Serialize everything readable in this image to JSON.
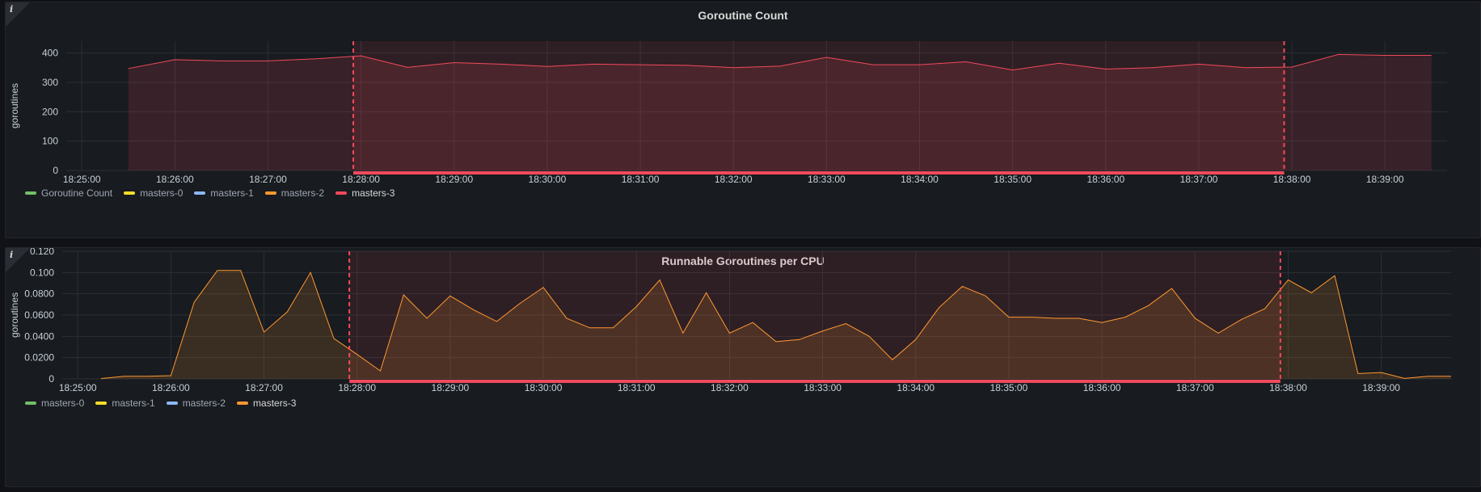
{
  "colors": {
    "grid": "#2c2f35",
    "tick": "#c7d0d9",
    "annotation": "#f2495c",
    "region": "rgba(242,73,92,0.10)"
  },
  "panels": [
    {
      "info_icon": "info-icon",
      "title": "Goroutine Count",
      "legend": [
        {
          "label": "Goroutine Count",
          "color": "#73bf69",
          "active": false
        },
        {
          "label": "masters-0",
          "color": "#fade2a",
          "active": false
        },
        {
          "label": "masters-1",
          "color": "#8ab8ff",
          "active": false
        },
        {
          "label": "masters-2",
          "color": "#ff9830",
          "active": false
        },
        {
          "label": "masters-3",
          "color": "#f2495c",
          "active": true
        }
      ]
    },
    {
      "info_icon": "info-icon",
      "title": "Runnable Goroutines per CPU",
      "legend": [
        {
          "label": "masters-0",
          "color": "#73bf69",
          "active": false
        },
        {
          "label": "masters-1",
          "color": "#fade2a",
          "active": false
        },
        {
          "label": "masters-2",
          "color": "#8ab8ff",
          "active": false
        },
        {
          "label": "masters-3",
          "color": "#ff9830",
          "active": true
        }
      ]
    }
  ],
  "chart_data": [
    {
      "type": "area",
      "title": "Goroutine Count",
      "ylabel": "goroutines",
      "xlim": [
        "18:24:50",
        "18:39:40"
      ],
      "ylim": [
        0,
        440
      ],
      "xticks": [
        "18:25:00",
        "18:26:00",
        "18:27:00",
        "18:28:00",
        "18:29:00",
        "18:30:00",
        "18:31:00",
        "18:32:00",
        "18:33:00",
        "18:34:00",
        "18:35:00",
        "18:36:00",
        "18:37:00",
        "18:38:00",
        "18:39:00"
      ],
      "yticks": [
        "0",
        "100",
        "200",
        "300",
        "400"
      ],
      "annotation_region": {
        "start": "18:27:55",
        "end": "18:37:55"
      },
      "grid": true,
      "legend_position": "bottom-left",
      "series": [
        {
          "name": "masters-3",
          "color": "#f2495c",
          "x": [
            "18:25:30",
            "18:26:00",
            "18:26:30",
            "18:27:00",
            "18:27:30",
            "18:28:00",
            "18:28:30",
            "18:29:00",
            "18:29:30",
            "18:30:00",
            "18:30:30",
            "18:31:00",
            "18:31:30",
            "18:32:00",
            "18:32:30",
            "18:33:00",
            "18:33:30",
            "18:34:00",
            "18:34:30",
            "18:35:00",
            "18:35:30",
            "18:36:00",
            "18:36:30",
            "18:37:00",
            "18:37:30",
            "18:38:00",
            "18:38:30",
            "18:39:00",
            "18:39:30"
          ],
          "values": [
            347,
            377,
            373,
            373,
            380,
            390,
            351,
            367,
            362,
            354,
            362,
            360,
            358,
            350,
            355,
            385,
            360,
            360,
            370,
            342,
            365,
            345,
            350,
            362,
            350,
            352,
            395,
            392,
            392
          ]
        }
      ]
    },
    {
      "type": "area",
      "title": "Runnable Goroutines per CPU",
      "ylabel": "goroutines",
      "xlim": [
        "18:24:50",
        "18:39:45"
      ],
      "ylim": [
        0,
        0.12
      ],
      "xticks": [
        "18:25:00",
        "18:26:00",
        "18:27:00",
        "18:28:00",
        "18:29:00",
        "18:30:00",
        "18:31:00",
        "18:32:00",
        "18:33:00",
        "18:34:00",
        "18:35:00",
        "18:36:00",
        "18:37:00",
        "18:38:00",
        "18:39:00"
      ],
      "yticks": [
        "0",
        "0.0200",
        "0.0400",
        "0.0600",
        "0.0800",
        "0.100",
        "0.120"
      ],
      "annotation_region": {
        "start": "18:27:55",
        "end": "18:37:55"
      },
      "grid": true,
      "legend_position": "bottom-left",
      "series": [
        {
          "name": "masters-3",
          "color": "#ff9830",
          "x": [
            "18:25:15",
            "18:25:30",
            "18:25:45",
            "18:26:00",
            "18:26:15",
            "18:26:30",
            "18:26:45",
            "18:27:00",
            "18:27:15",
            "18:27:30",
            "18:27:45",
            "18:28:00",
            "18:28:15",
            "18:28:30",
            "18:28:45",
            "18:29:00",
            "18:29:15",
            "18:29:30",
            "18:29:45",
            "18:30:00",
            "18:30:15",
            "18:30:30",
            "18:30:45",
            "18:31:00",
            "18:31:15",
            "18:31:30",
            "18:31:45",
            "18:32:00",
            "18:32:15",
            "18:32:30",
            "18:32:45",
            "18:33:00",
            "18:33:15",
            "18:33:30",
            "18:33:45",
            "18:34:00",
            "18:34:15",
            "18:34:30",
            "18:34:45",
            "18:35:00",
            "18:35:15",
            "18:35:30",
            "18:35:45",
            "18:36:00",
            "18:36:15",
            "18:36:30",
            "18:36:45",
            "18:37:00",
            "18:37:15",
            "18:37:30",
            "18:37:45",
            "18:38:00",
            "18:38:15",
            "18:38:30",
            "18:38:45",
            "18:39:00",
            "18:39:15",
            "18:39:30",
            "18:39:45"
          ],
          "values": [
            0.0003,
            0.0025,
            0.0025,
            0.003,
            0.072,
            0.102,
            0.102,
            0.044,
            0.063,
            0.1,
            0.038,
            0.023,
            0.0075,
            0.079,
            0.057,
            0.078,
            0.065,
            0.054,
            0.071,
            0.086,
            0.057,
            0.048,
            0.048,
            0.068,
            0.093,
            0.043,
            0.081,
            0.043,
            0.053,
            0.035,
            0.037,
            0.045,
            0.052,
            0.04,
            0.018,
            0.037,
            0.067,
            0.087,
            0.078,
            0.058,
            0.058,
            0.057,
            0.057,
            0.053,
            0.058,
            0.069,
            0.085,
            0.057,
            0.043,
            0.056,
            0.066,
            0.093,
            0.081,
            0.097,
            0.005,
            0.006,
            0.0005,
            0.0025,
            0.0025
          ]
        }
      ]
    }
  ]
}
